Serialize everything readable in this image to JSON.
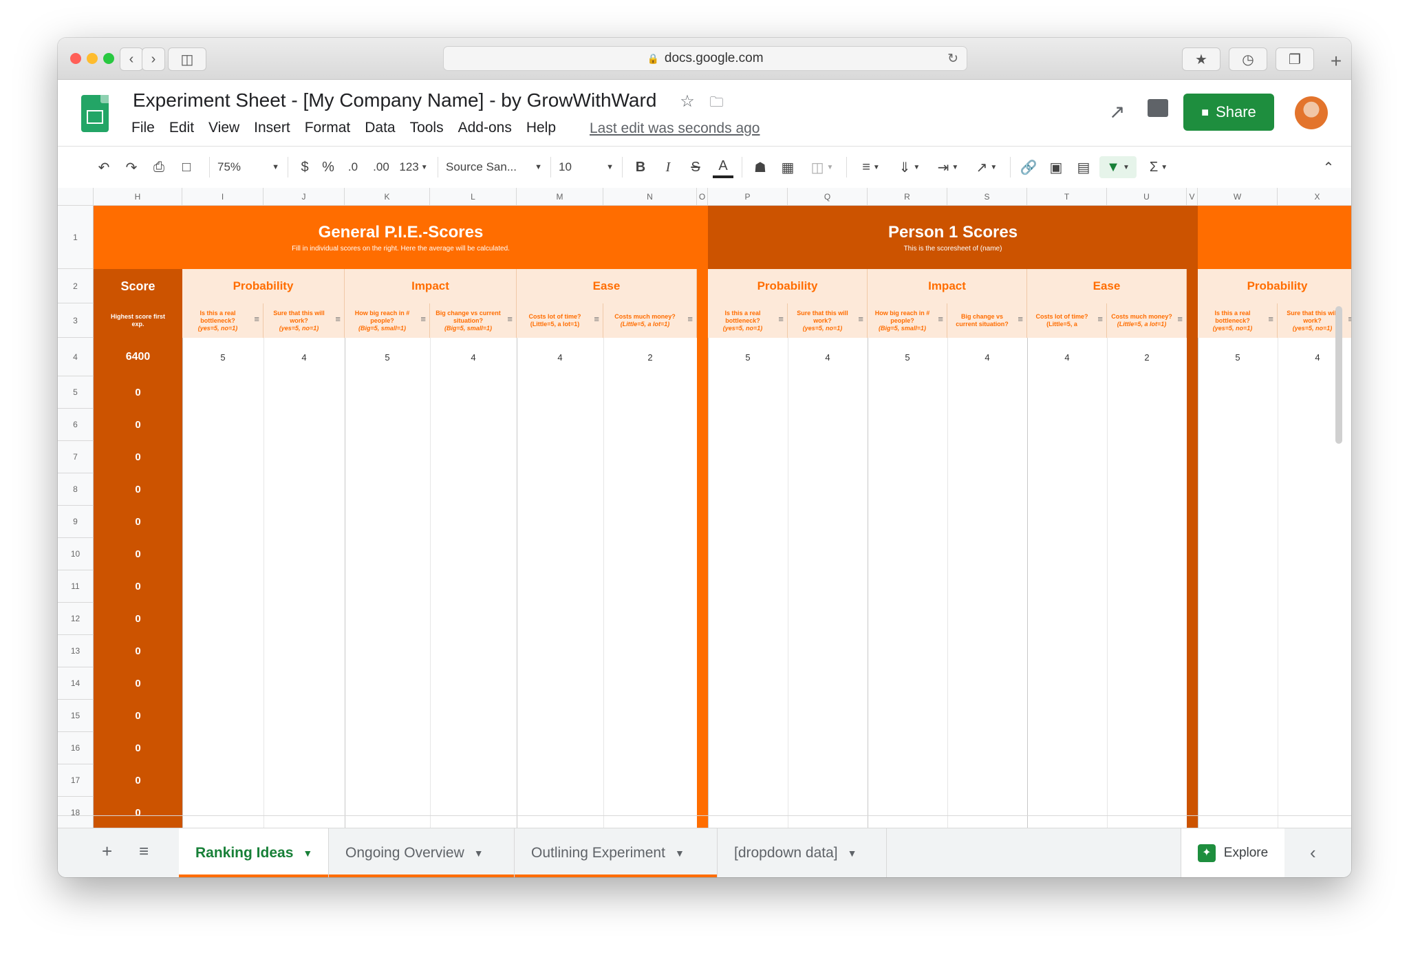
{
  "browser": {
    "url": "docs.google.com",
    "traffic_colors": [
      "#ff5f57",
      "#febc2e",
      "#28c840"
    ]
  },
  "app": {
    "title": "Experiment Sheet - [My Company Name] - by GrowWithWard",
    "menu": [
      "File",
      "Edit",
      "View",
      "Insert",
      "Format",
      "Data",
      "Tools",
      "Add-ons",
      "Help"
    ],
    "last_edit": "Last edit was seconds ago",
    "share_label": "Share",
    "accent": "#1e8e3e"
  },
  "toolbar": {
    "zoom": "75%",
    "currency": "$",
    "percent": "%",
    "dec_less": ".0",
    "dec_more": ".00",
    "format_more": "123",
    "font": "Source San...",
    "font_size": "10"
  },
  "sheet": {
    "columns": [
      "H",
      "I",
      "J",
      "K",
      "L",
      "M",
      "N",
      "O",
      "P",
      "Q",
      "R",
      "S",
      "T",
      "U",
      "V",
      "W",
      "X"
    ],
    "rows": [
      "1",
      "2",
      "3",
      "4",
      "5",
      "6",
      "7",
      "8",
      "9",
      "10",
      "11",
      "12",
      "13",
      "14",
      "15",
      "16",
      "17",
      "18"
    ],
    "general": {
      "title": "General P.I.E.-Scores",
      "subtitle": "Fill in individual scores on the right. Here the average will be calculated."
    },
    "person1": {
      "title": "Person 1 Scores",
      "subtitle": "This is the scoresheet of (name)"
    },
    "score_label": "Score",
    "score_note": "Highest score first exp.",
    "groups": {
      "probability": "Probability",
      "impact": "Impact",
      "ease": "Ease"
    },
    "questions": [
      {
        "q": "Is this a real bottleneck?",
        "hint": "(yes=5, no=1)"
      },
      {
        "q": "Sure that this will work?",
        "hint": "(yes=5, no=1)"
      },
      {
        "q": "How big reach in # people?",
        "hint": "(Big=5, small=1)"
      },
      {
        "q": "Big change vs current situation?",
        "hint": "(Big=5, small=1)"
      },
      {
        "q": "Costs lot of time? (Little=5, a lot=1)",
        "hint": ""
      },
      {
        "q": "Costs much money?",
        "hint": "(Little=5, a lot=1)"
      }
    ],
    "questions_p1": [
      {
        "q": "Is this a real bottleneck?",
        "hint": "(yes=5, no=1)"
      },
      {
        "q": "Sure that this will work?",
        "hint": "(yes=5, no=1)"
      },
      {
        "q": "How big reach in # people?",
        "hint": "(Big=5, small=1)"
      },
      {
        "q": "Big change vs current situation?",
        "hint": ""
      },
      {
        "q": "Costs lot of time? (Little=5, a",
        "hint": ""
      },
      {
        "q": "Costs much money?",
        "hint": "(Little=5, a lot=1)"
      }
    ],
    "questions_w": [
      {
        "q": "Is this a real bottleneck?",
        "hint": "(yes=5, no=1)"
      },
      {
        "q": "Sure that this will work?",
        "hint": "(yes=5, no=1)"
      }
    ],
    "row4_score": "6400",
    "row4_general": [
      "5",
      "4",
      "5",
      "4",
      "4",
      "2"
    ],
    "row4_person1": [
      "5",
      "4",
      "5",
      "4",
      "4",
      "2"
    ],
    "row4_w": [
      "5",
      "4"
    ],
    "score_values": [
      "0",
      "0",
      "0",
      "0",
      "0",
      "0",
      "0",
      "0",
      "0",
      "0",
      "0",
      "0",
      "0",
      "0"
    ],
    "band_color": "#ff6d00",
    "band_dark": "#cc5300",
    "subhead_bg": "#fde9d9"
  },
  "tabs": [
    {
      "label": "Ranking Ideas",
      "active": true
    },
    {
      "label": "Ongoing Overview",
      "active": false
    },
    {
      "label": "Outlining Experiment",
      "active": false
    },
    {
      "label": "[dropdown data]",
      "active": false
    }
  ],
  "explore_label": "Explore"
}
